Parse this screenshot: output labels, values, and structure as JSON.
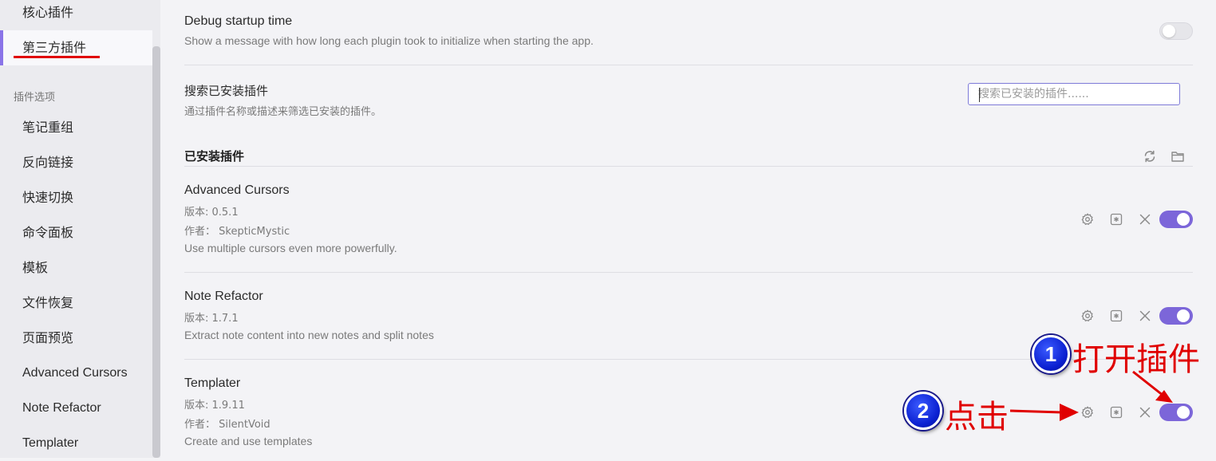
{
  "sidebar": {
    "items": [
      {
        "label": "核心插件"
      },
      {
        "label": "第三方插件",
        "active": true
      }
    ],
    "section_title": "插件选项",
    "options": [
      {
        "label": "笔记重组"
      },
      {
        "label": "反向链接"
      },
      {
        "label": "快速切换"
      },
      {
        "label": "命令面板"
      },
      {
        "label": "模板"
      },
      {
        "label": "文件恢复"
      },
      {
        "label": "页面预览"
      },
      {
        "label": "Advanced Cursors"
      },
      {
        "label": "Note Refactor"
      },
      {
        "label": "Templater"
      }
    ]
  },
  "debug": {
    "title": "Debug startup time",
    "description": "Show a message with how long each plugin took to initialize when starting the app.",
    "enabled": false
  },
  "search": {
    "title": "搜索已安装插件",
    "description": "通过插件名称或描述来筛选已安装的插件。",
    "placeholder": "搜索已安装的插件......",
    "value": ""
  },
  "installed": {
    "heading": "已安装插件",
    "reload_icon": "reload-icon",
    "folder_icon": "folder-icon"
  },
  "plugins": [
    {
      "name": "Advanced Cursors",
      "version": "版本: 0.5.1",
      "author": "作者： SkepticMystic",
      "description": "Use multiple cursors even more powerfully.",
      "enabled": true
    },
    {
      "name": "Note Refactor",
      "version": "版本: 1.7.1",
      "description": "Extract note content into new notes and split notes",
      "enabled": true
    },
    {
      "name": "Templater",
      "version": "版本: 1.9.11",
      "author": "作者： SilentVoid",
      "description": "Create and use templates",
      "enabled": true
    }
  ],
  "annotations": {
    "step1_number": "1",
    "step1_text": "打开插件",
    "step2_number": "2",
    "step2_text": "点击"
  },
  "colors": {
    "accent": "#7c66d9",
    "annotation_red": "#e00000",
    "badge_blue": "#0a1fd0"
  }
}
